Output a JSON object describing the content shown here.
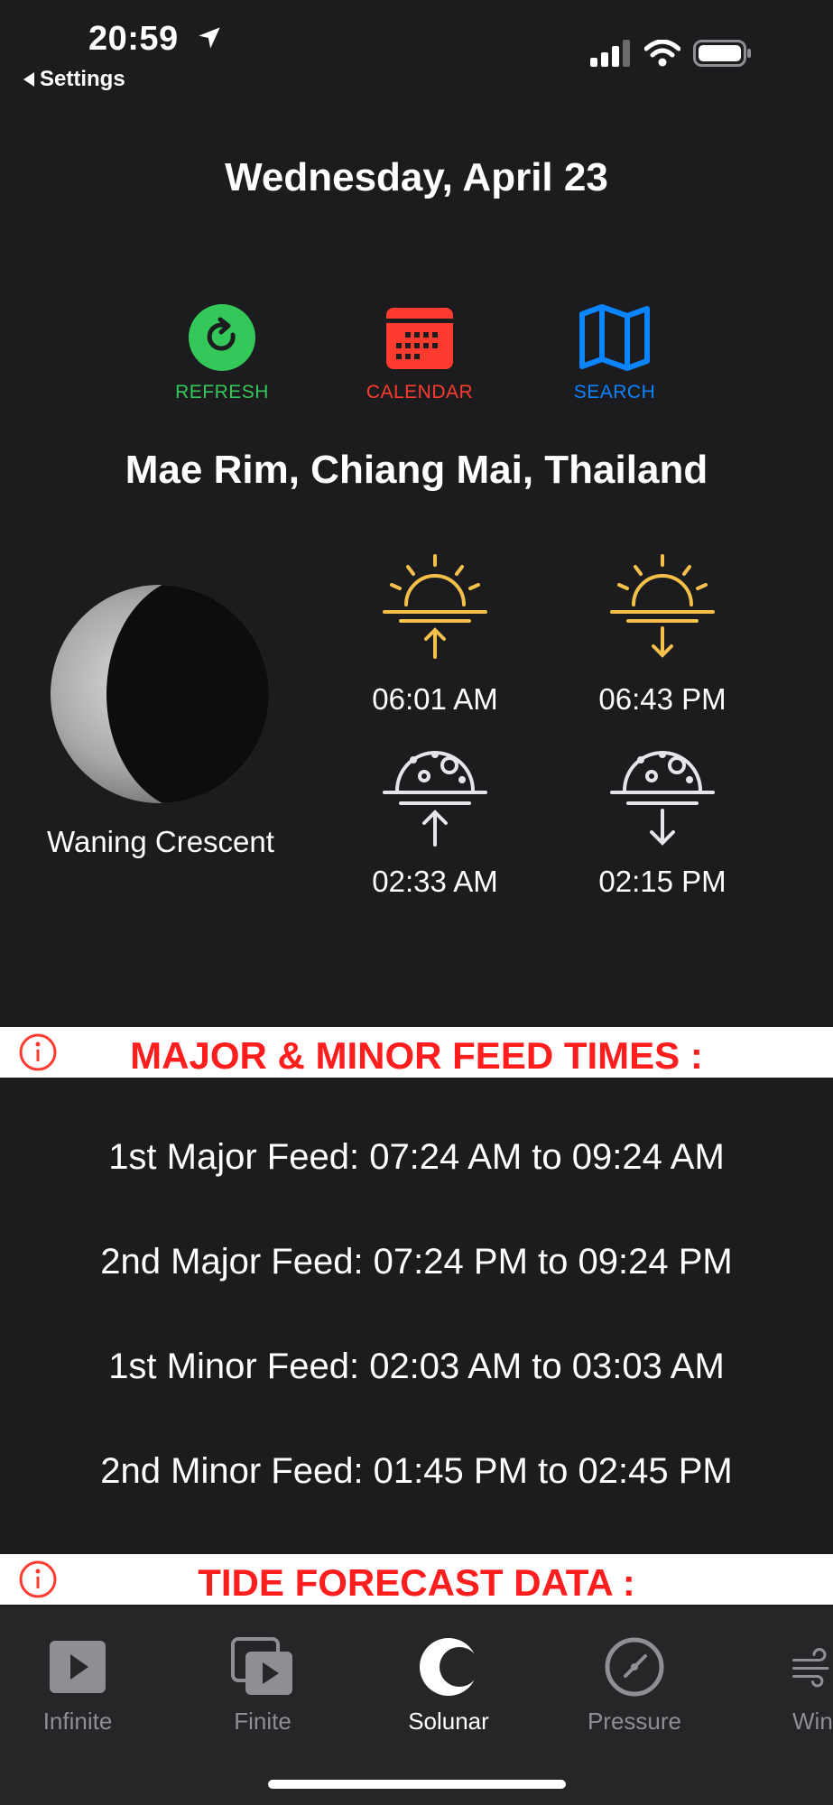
{
  "status_bar": {
    "time": "20:59",
    "back_label": "Settings"
  },
  "header": {
    "date": "Wednesday, April 23"
  },
  "actions": {
    "refresh": "REFRESH",
    "calendar": "CALENDAR",
    "search": "SEARCH"
  },
  "location": "Mae Rim, Chiang Mai, Thailand",
  "moon": {
    "phase": "Waning Crescent"
  },
  "astro": {
    "sunrise": "06:01 AM",
    "sunset": "06:43 PM",
    "moonrise": "02:33 AM",
    "moonset": "02:15 PM"
  },
  "feed_section": {
    "title": "MAJOR & MINOR FEED TIMES :",
    "items": [
      "1st Major Feed: 07:24 AM to 09:24 AM",
      "2nd Major Feed: 07:24 PM to 09:24 PM",
      "1st Minor Feed: 02:03 AM to 03:03 AM",
      "2nd Minor Feed: 01:45 PM to 02:45 PM"
    ]
  },
  "tide_section": {
    "title": "TIDE FORECAST DATA :"
  },
  "tabs": [
    {
      "label": "Infinite",
      "icon": "play-square-icon"
    },
    {
      "label": "Finite",
      "icon": "stacked-play-icon"
    },
    {
      "label": "Solunar",
      "icon": "moon-icon"
    },
    {
      "label": "Pressure",
      "icon": "gauge-icon"
    },
    {
      "label": "Win",
      "icon": "wind-icon"
    }
  ],
  "colors": {
    "green": "#34c759",
    "red": "#ff3b30",
    "blue": "#0a84ff",
    "gold": "#f5c04a",
    "banner_red": "#ff1d1d"
  }
}
